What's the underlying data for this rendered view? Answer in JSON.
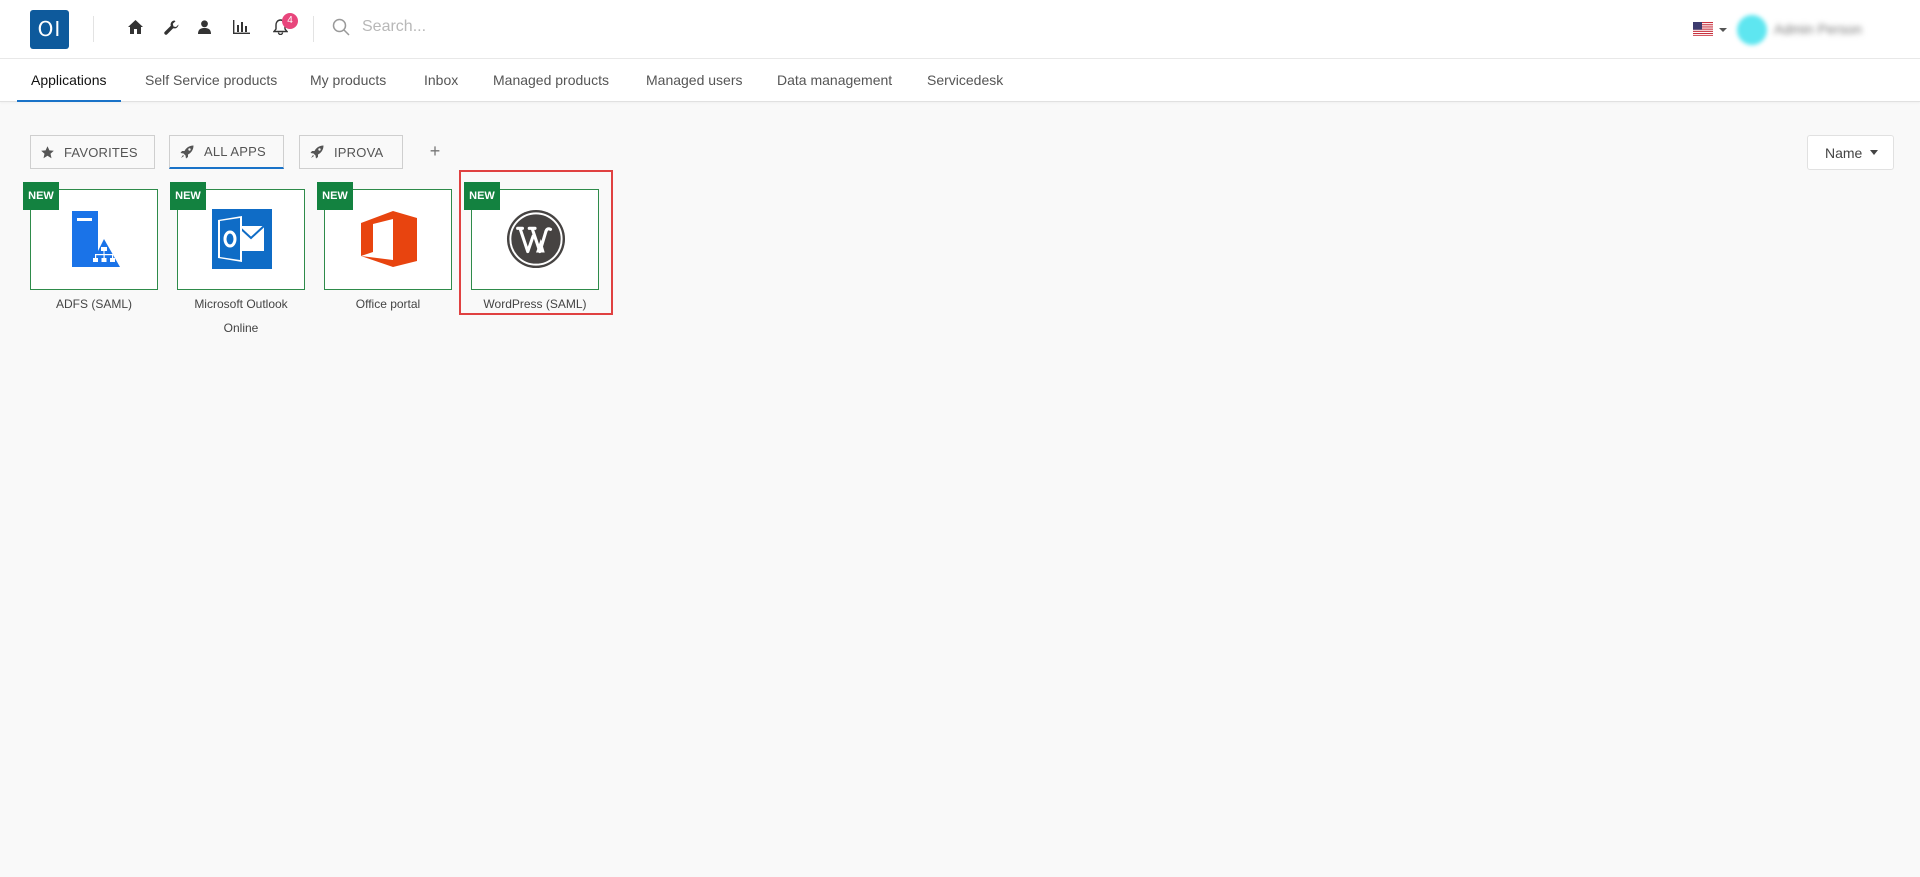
{
  "header": {
    "logo_text": "OI",
    "notifications_count": "4",
    "search_placeholder": "Search...",
    "language": "en-US",
    "user_name": "Admin Person"
  },
  "nav": {
    "tabs": [
      {
        "label": "Applications",
        "active": true
      },
      {
        "label": "Self Service products",
        "active": false
      },
      {
        "label": "My products",
        "active": false
      },
      {
        "label": "Inbox",
        "active": false
      },
      {
        "label": "Managed products",
        "active": false
      },
      {
        "label": "Managed users",
        "active": false
      },
      {
        "label": "Data management",
        "active": false
      },
      {
        "label": "Servicedesk",
        "active": false
      }
    ]
  },
  "filters": {
    "chips": [
      {
        "label": "FAVORITES",
        "icon": "star-icon",
        "active": false
      },
      {
        "label": "ALL APPS",
        "icon": "rocket-icon",
        "active": true
      },
      {
        "label": "IPROVA",
        "icon": "rocket-icon",
        "active": false
      }
    ],
    "add_label": "+",
    "sort_label": "Name"
  },
  "apps": [
    {
      "name": "ADFS (SAML)",
      "badge": "NEW",
      "icon": "adfs-server-icon"
    },
    {
      "name": "Microsoft Outlook Online",
      "badge": "NEW",
      "icon": "outlook-icon"
    },
    {
      "name": "Office portal",
      "badge": "NEW",
      "icon": "office-icon"
    },
    {
      "name": "WordPress (SAML)",
      "badge": "NEW",
      "icon": "wordpress-icon"
    }
  ],
  "colors": {
    "brand": "#0e5a9c",
    "accent": "#1a73c8",
    "new_badge": "#138240",
    "tile_border": "#2e8b4a",
    "notification_badge": "#e8467c",
    "highlight": "#e04141"
  }
}
